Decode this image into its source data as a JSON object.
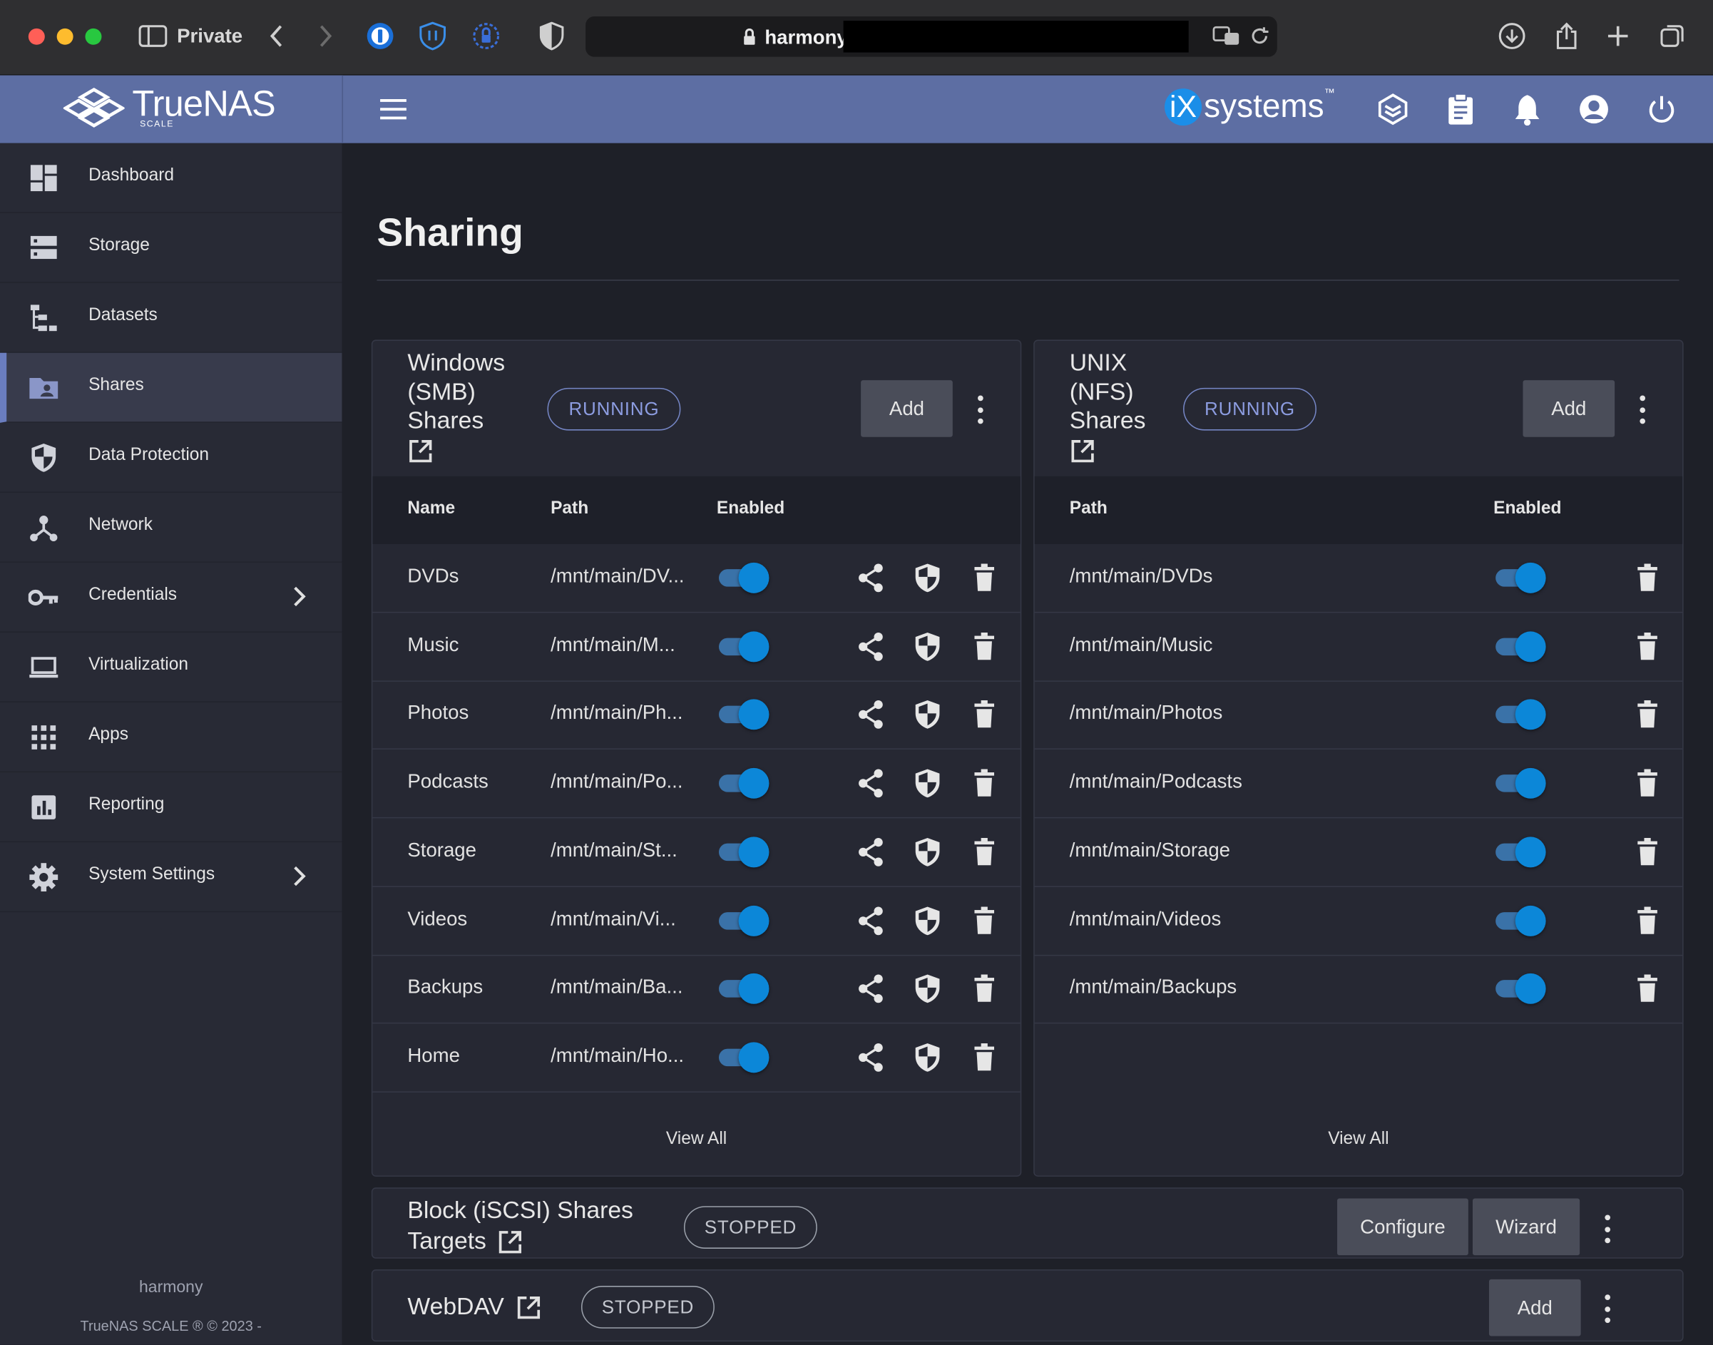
{
  "browser": {
    "private_label": "Private",
    "url": "harmony.",
    "colors": {
      "close": "#ff5f57",
      "minimize": "#febc2e",
      "maximize": "#28c840"
    }
  },
  "header": {
    "logo_text": "TrueNAS",
    "logo_sub": "SCALE",
    "vendor_prefix": "iX",
    "vendor_text": "systems",
    "vendor_mark": "™"
  },
  "sidebar": {
    "items": [
      {
        "label": "Dashboard",
        "icon": "dashboard-icon"
      },
      {
        "label": "Storage",
        "icon": "storage-icon"
      },
      {
        "label": "Datasets",
        "icon": "datasets-icon"
      },
      {
        "label": "Shares",
        "icon": "shares-folder-icon",
        "active": true
      },
      {
        "label": "Data Protection",
        "icon": "shield-icon"
      },
      {
        "label": "Network",
        "icon": "network-icon"
      },
      {
        "label": "Credentials",
        "icon": "key-icon",
        "expandable": true
      },
      {
        "label": "Virtualization",
        "icon": "laptop-icon"
      },
      {
        "label": "Apps",
        "icon": "apps-grid-icon"
      },
      {
        "label": "Reporting",
        "icon": "reporting-icon"
      },
      {
        "label": "System Settings",
        "icon": "gear-icon",
        "expandable": true
      }
    ],
    "hostname": "harmony",
    "footer": "TrueNAS SCALE ® © 2023 -"
  },
  "page": {
    "title": "Sharing"
  },
  "smb": {
    "title_l1": "Windows",
    "title_l2": "(SMB)",
    "title_l3": "Shares",
    "status": "RUNNING",
    "add_label": "Add",
    "columns": [
      "Name",
      "Path",
      "Enabled"
    ],
    "rows": [
      {
        "name": "DVDs",
        "path": "/mnt/main/DV...",
        "enabled": true
      },
      {
        "name": "Music",
        "path": "/mnt/main/M...",
        "enabled": true
      },
      {
        "name": "Photos",
        "path": "/mnt/main/Ph...",
        "enabled": true
      },
      {
        "name": "Podcasts",
        "path": "/mnt/main/Po...",
        "enabled": true
      },
      {
        "name": "Storage",
        "path": "/mnt/main/St...",
        "enabled": true
      },
      {
        "name": "Videos",
        "path": "/mnt/main/Vi...",
        "enabled": true
      },
      {
        "name": "Backups",
        "path": "/mnt/main/Ba...",
        "enabled": true
      },
      {
        "name": "Home",
        "path": "/mnt/main/Ho...",
        "enabled": true
      }
    ],
    "view_all": "View All"
  },
  "nfs": {
    "title_l1": "UNIX",
    "title_l2": "(NFS)",
    "title_l3": "Shares",
    "status": "RUNNING",
    "add_label": "Add",
    "columns": [
      "Path",
      "Enabled"
    ],
    "rows": [
      {
        "path": "/mnt/main/DVDs",
        "enabled": true
      },
      {
        "path": "/mnt/main/Music",
        "enabled": true
      },
      {
        "path": "/mnt/main/Photos",
        "enabled": true
      },
      {
        "path": "/mnt/main/Podcasts",
        "enabled": true
      },
      {
        "path": "/mnt/main/Storage",
        "enabled": true
      },
      {
        "path": "/mnt/main/Videos",
        "enabled": true
      },
      {
        "path": "/mnt/main/Backups",
        "enabled": true
      }
    ],
    "view_all": "View All"
  },
  "iscsi": {
    "title_l1": "Block (iSCSI) Shares",
    "title_l2": "Targets",
    "status": "STOPPED",
    "configure_label": "Configure",
    "wizard_label": "Wizard"
  },
  "webdav": {
    "title": "WebDAV",
    "status": "STOPPED",
    "add_label": "Add"
  },
  "colors": {
    "accent": "#5d6ea3",
    "toggle_on": "#0c87d8",
    "running": "#8c9ce0",
    "stopped": "#c4c7cf"
  }
}
